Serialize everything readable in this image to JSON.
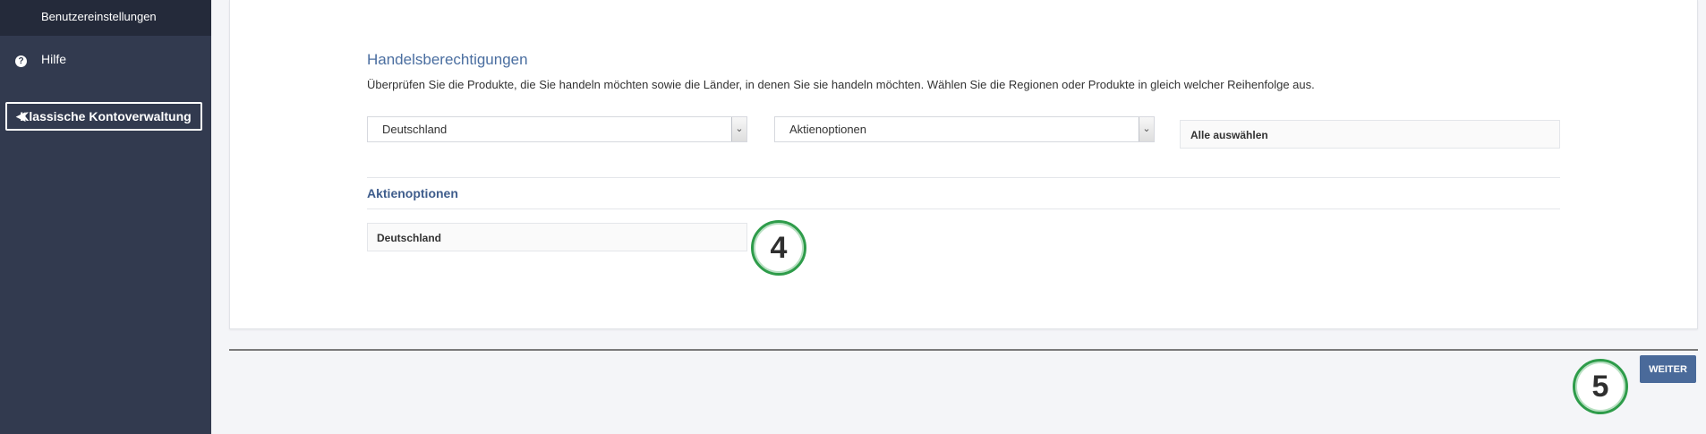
{
  "sidebar": {
    "top_label": "Benutzereinstellungen",
    "help_label": "Hilfe",
    "classic_button": "Klassische Kontoverwaltung"
  },
  "trading": {
    "title": "Handelsberechtigungen",
    "description": "Überprüfen Sie die Produkte, die Sie handeln möchten sowie die Länder, in denen Sie sie handeln möchten. Wählen Sie die Regionen oder Produkte in gleich welcher Reihenfolge aus.",
    "country_select": "Deutschland",
    "product_select": "Aktienoptionen",
    "select_all": "Alle auswählen",
    "product_heading": "Aktienoptionen",
    "selected_country": "Deutschland"
  },
  "steps": {
    "step4": "4",
    "step5": "5"
  },
  "footer": {
    "next_button": "WEITER"
  },
  "colors": {
    "sidebar": "#323a4f",
    "accent": "#4a6a9a",
    "step_ring": "#2e9c4a"
  }
}
